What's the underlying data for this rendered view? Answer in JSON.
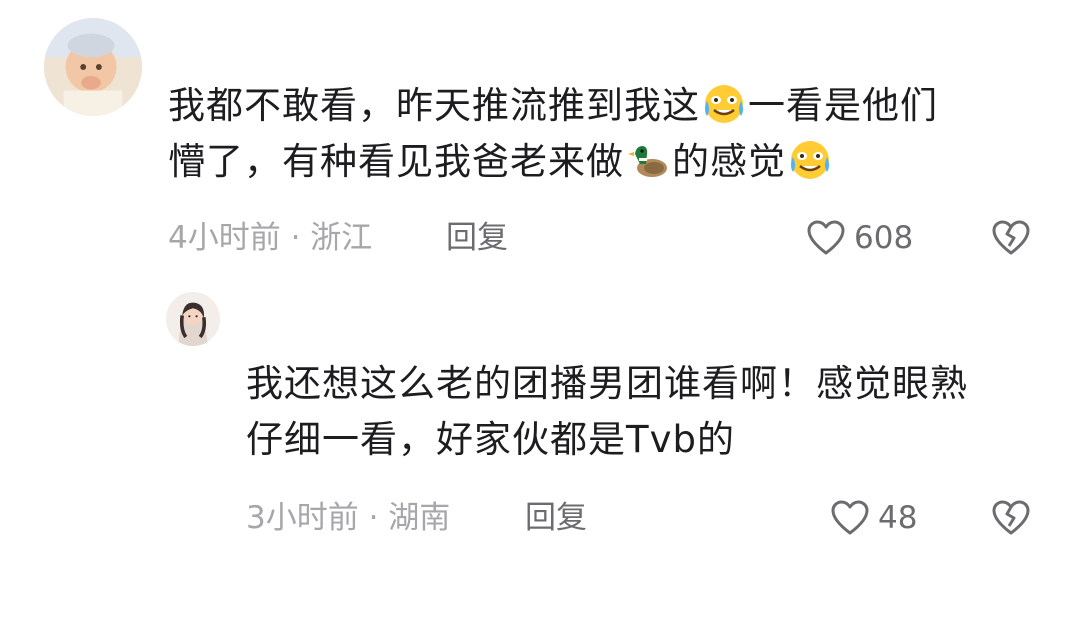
{
  "comments": [
    {
      "avatar": "baby-avatar",
      "line1_a": "我都不敢看，昨天推流推到我这",
      "emoji1": "crying-laughing-emoji",
      "line1_b": "一看是他们",
      "line2_a": "懵了，有种看见我爸老来做",
      "emoji2": "duck-emoji",
      "line2_b": "的感觉",
      "emoji3": "crying-laughing-emoji",
      "meta": "4小时前 · 浙江",
      "reply": "回复",
      "likes": "608"
    },
    {
      "avatar": "girl-avatar",
      "line1": "我还想这么老的团播男团谁看啊！感觉眼熟",
      "line2": "仔细一看，好家伙都是Tvb的",
      "meta": "3小时前 · 湖南",
      "reply": "回复",
      "likes": "48"
    }
  ],
  "icons": {
    "like": "heart-outline-icon",
    "dislike": "broken-heart-outline-icon"
  },
  "colors": {
    "text": "#1d1d1f",
    "meta": "#a7a7ab",
    "action": "#6c6c70"
  }
}
